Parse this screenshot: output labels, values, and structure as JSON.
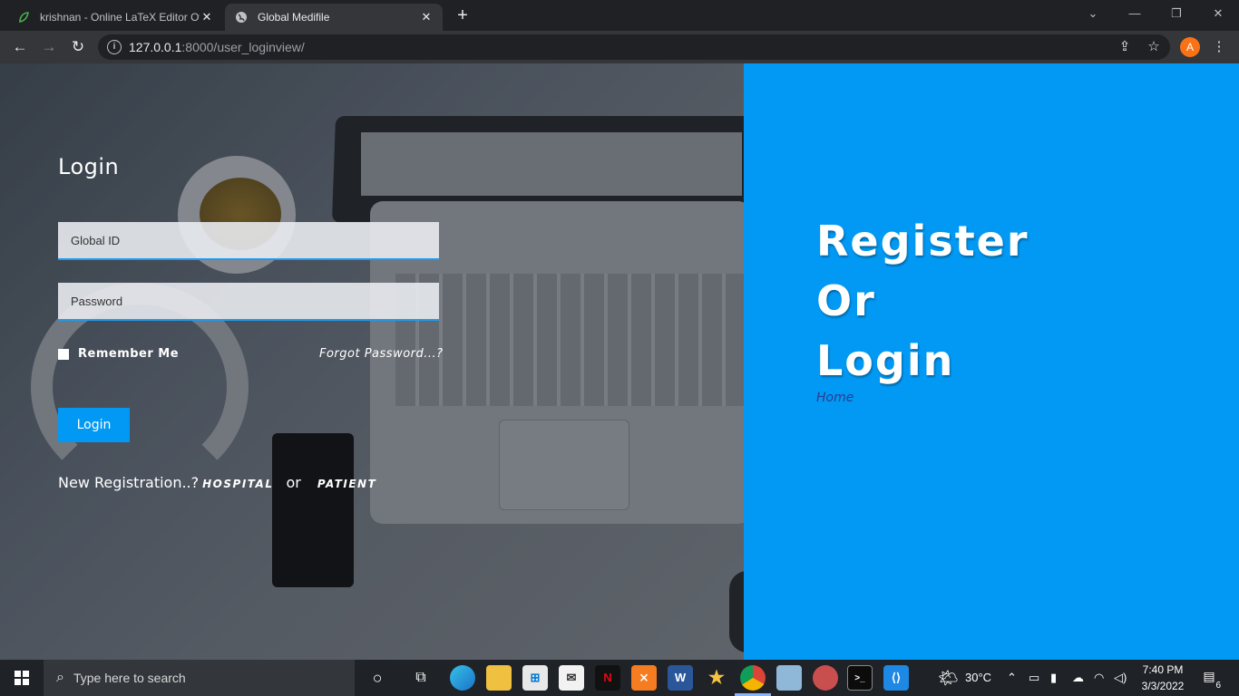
{
  "browser": {
    "tabs": [
      {
        "title": "krishnan - Online LaTeX Editor Ov",
        "close": "✕"
      },
      {
        "title": "Global Medifile",
        "close": "✕"
      }
    ],
    "new_tab": "+",
    "url_host": "127.0.0.1",
    "url_path": ":8000/user_loginview/",
    "profile_initial": "A"
  },
  "login": {
    "heading": "Login",
    "global_id_placeholder": "Global ID",
    "password_placeholder": "Password",
    "remember_me": "Remember Me",
    "forgot_password": "Forgot Password...?",
    "login_button": "Login",
    "new_registration": "New Registration..?",
    "hospital_link": "HOSPITAL",
    "or_text": "or",
    "patient_link": "PATIENT"
  },
  "hero": {
    "line1": "Register",
    "line2": "Or",
    "line3": "Login",
    "home_link": "Home"
  },
  "taskbar": {
    "search_placeholder": "Type here to search",
    "temperature": "30°C",
    "time": "7:40 PM",
    "date": "3/3/2022",
    "notification_count": "6"
  },
  "colors": {
    "accent": "#0299f4",
    "home_link": "#2a3c8f",
    "input_underline": "#1e9bef"
  }
}
